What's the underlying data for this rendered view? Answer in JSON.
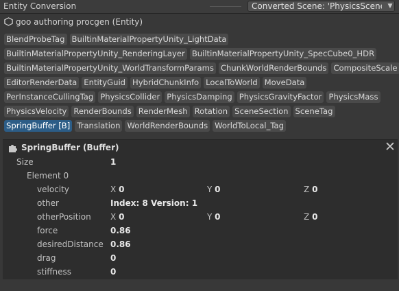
{
  "window": {
    "title": "Entity Conversion",
    "scene_selector": "Converted Scene: 'PhysicsScene"
  },
  "entity": {
    "name": "goo authoring procgen (Entity)",
    "icon": "cube-outline-icon"
  },
  "component_tags": [
    [
      "BlendProbeTag",
      "BuiltinMaterialPropertyUnity_LightData"
    ],
    [
      "BuiltinMaterialPropertyUnity_RenderingLayer",
      "BuiltinMaterialPropertyUnity_SpecCube0_HDR"
    ],
    [
      "BuiltinMaterialPropertyUnity_WorldTransformParams",
      "ChunkWorldRenderBounds",
      "CompositeScale"
    ],
    [
      "EditorRenderData",
      "EntityGuid",
      "HybridChunkInfo",
      "LocalToWorld",
      "MoveData"
    ],
    [
      "PerInstanceCullingTag",
      "PhysicsCollider",
      "PhysicsDamping",
      "PhysicsGravityFactor",
      "PhysicsMass"
    ],
    [
      "PhysicsVelocity",
      "RenderBounds",
      "RenderMesh",
      "Rotation",
      "SceneSection",
      "SceneTag"
    ],
    [
      "SpringBuffer [B]",
      "Translation",
      "WorldRenderBounds",
      "WorldToLocal_Tag"
    ]
  ],
  "selected_tag": "SpringBuffer [B]",
  "inspector": {
    "title": "SpringBuffer (Buffer)",
    "size_label": "Size",
    "size_value": "1",
    "element_label": "Element 0",
    "velocity": {
      "label": "velocity",
      "x_label": "X",
      "x": "0",
      "y_label": "Y",
      "y": "0",
      "z_label": "Z",
      "z": "0"
    },
    "other": {
      "label": "other",
      "value": "Index: 8 Version: 1"
    },
    "other_position": {
      "label": "otherPosition",
      "x_label": "X",
      "x": "0",
      "y_label": "Y",
      "y": "0",
      "z_label": "Z",
      "z": "0"
    },
    "force": {
      "label": "force",
      "value": "0.86"
    },
    "desired_distance": {
      "label": "desiredDistance",
      "value": "0.86"
    },
    "drag": {
      "label": "drag",
      "value": "0"
    },
    "stiffness": {
      "label": "stiffness",
      "value": "0"
    }
  },
  "colors": {
    "selected_tag": "#2c5d87",
    "tag_bg": "#4a4a4a",
    "panel_bg": "#2d2d2d",
    "window_bg": "#383838"
  }
}
